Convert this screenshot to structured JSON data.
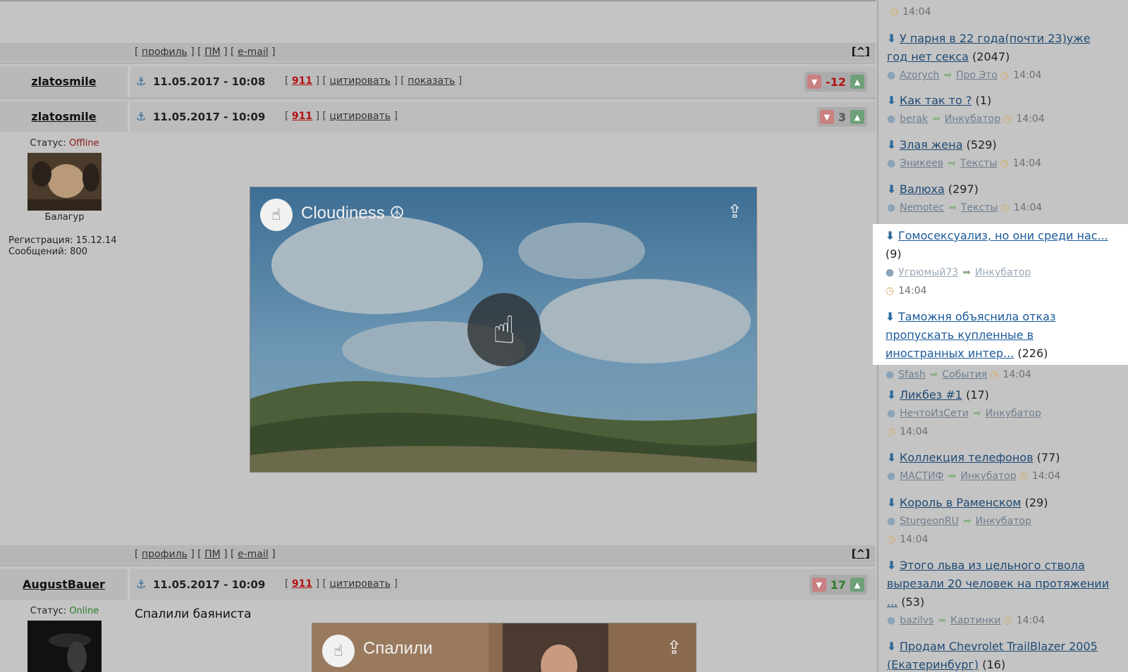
{
  "post_actions": {
    "profile": "профиль",
    "pm": "ПМ",
    "email": "e-mail",
    "to_top": "[^]"
  },
  "posts": [
    {
      "author": "zlatosmile",
      "date": "11.05.2017 - 10:08",
      "n911": "911",
      "quote": "цитировать",
      "show": "показать",
      "rating": "-12"
    },
    {
      "author": "zlatosmile",
      "date": "11.05.2017 - 10:09",
      "n911": "911",
      "quote": "цитировать",
      "rating": "3",
      "status_label": "Статус:",
      "status": "Offline",
      "rank": "Балагур",
      "registration": "Регистрация: 15.12.14",
      "messages": "Сообщений: 800",
      "video_title": "Cloudiness ☮"
    },
    {
      "author": "AugustBauer",
      "date": "11.05.2017 - 10:09",
      "n911": "911",
      "quote": "цитировать",
      "rating": "17",
      "status_label": "Статус:",
      "status": "Online",
      "text": "Спалили баяниста",
      "video_title": "Спалили"
    }
  ],
  "sidebar": {
    "top_time": "14:04",
    "entries": [
      {
        "title": "У парня в 22 года(почти 23)уже год нет секса",
        "count": "(2047)",
        "user": "Azorych",
        "section": "Про Это",
        "time": "14:04"
      },
      {
        "title": "Как так то ?",
        "count": "(1)",
        "user": "berak",
        "section": "Инкубатор",
        "time": "14:04"
      },
      {
        "title": "Злая жена",
        "count": "(529)",
        "user": "Эникеев",
        "section": "Тексты",
        "time": "14:04"
      },
      {
        "title": "Валюха",
        "count": "(297)",
        "user": "Nemotec",
        "section": "Тексты",
        "time": "14:04"
      },
      {
        "title": "Гомосексуализ, но они среди нас...",
        "count": "(9)",
        "user": "Угрюмый73",
        "section": "Инкубатор",
        "time": "14:04"
      },
      {
        "title": "Таможня объяснила отказ пропускать купленные в иностранных интер...",
        "count": "(226)",
        "user": "Sfash",
        "section": "События",
        "time": "14:04"
      },
      {
        "title": "Ликбез #1",
        "count": "(17)",
        "user": "НечтоИзСети",
        "section": "Инкубатор",
        "time": "14:04"
      },
      {
        "title": "Коллекция телефонов",
        "count": "(77)",
        "user": "МАСТИФ",
        "section": "Инкубатор",
        "time": "14:04"
      },
      {
        "title": "Король в Раменском",
        "count": "(29)",
        "user": "SturgeonRU",
        "section": "Инкубатор",
        "time": "14:04"
      },
      {
        "title": "Этого льва из цельного ствола вырезали 20 человек на протяжении ...",
        "count": "(53)",
        "user": "bazilvs",
        "section": "Картинки",
        "time": "14:04"
      },
      {
        "title": "Продам Chevrolet TrailBlazer 2005 (Екатеринбург)",
        "count": "(16)"
      }
    ]
  },
  "colors": {
    "page_dim": "#c4c4c4",
    "highlight": "#ffffff",
    "link": "#1a5a9a",
    "negative": "#b31212",
    "positive": "#2c7d2c"
  }
}
